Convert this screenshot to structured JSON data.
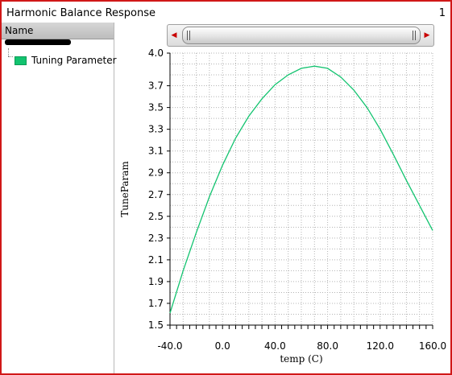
{
  "window": {
    "title": "Harmonic Balance Response",
    "page_number": "1"
  },
  "left_panel": {
    "header": "Name",
    "legend_label": "Tuning Parameter"
  },
  "colors": {
    "series": "#12c36f",
    "window_border": "#d01818",
    "scroll_arrows": "#c80000"
  },
  "icons": {
    "scroll_left": "left-arrow-icon",
    "scroll_right": "right-arrow-icon"
  },
  "chart_data": {
    "type": "line",
    "xlabel": "temp (C)",
    "ylabel": "TuneParam",
    "xlim": [
      -40,
      160
    ],
    "ylim": [
      1.5,
      4.0
    ],
    "x_ticks": [
      -40,
      0,
      40,
      80,
      120,
      160
    ],
    "x_tick_labels": [
      "-40.0",
      "0.0",
      "40.0",
      "80.0",
      "120.0",
      "160.0"
    ],
    "y_ticks": [
      1.5,
      1.7,
      1.9,
      2.1,
      2.3,
      2.5,
      2.7,
      2.9,
      3.1,
      3.3,
      3.5,
      3.7,
      4.0
    ],
    "y_tick_labels": [
      "1.5",
      "1.7",
      "1.9",
      "2.1",
      "2.3",
      "2.5",
      "2.7",
      "2.9",
      "3.1",
      "3.3",
      "3.5",
      "3.7",
      "4.0"
    ],
    "grid": true,
    "series": [
      {
        "name": "Tuning Parameter",
        "x": [
          -40,
          -30,
          -20,
          -10,
          0,
          10,
          20,
          30,
          40,
          50,
          60,
          70,
          80,
          90,
          100,
          110,
          120,
          130,
          140,
          150,
          160
        ],
        "y": [
          1.61,
          2.0,
          2.35,
          2.68,
          2.97,
          3.22,
          3.42,
          3.58,
          3.71,
          3.8,
          3.86,
          3.88,
          3.86,
          3.78,
          3.66,
          3.5,
          3.3,
          3.07,
          2.83,
          2.6,
          2.37
        ]
      }
    ]
  }
}
